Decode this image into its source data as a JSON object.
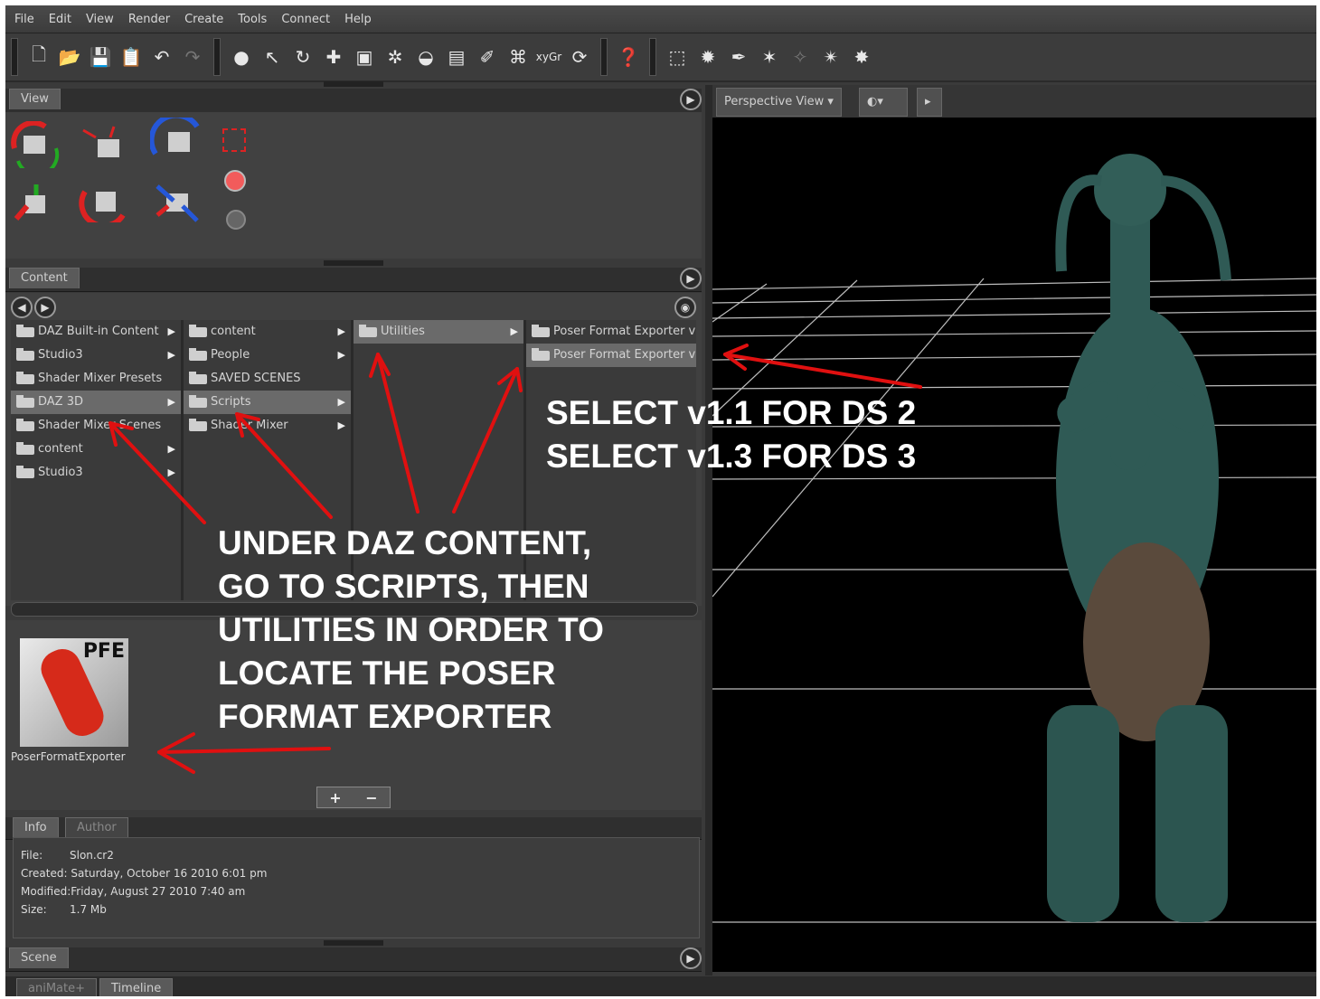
{
  "menu": [
    "File",
    "Edit",
    "View",
    "Render",
    "Create",
    "Tools",
    "Connect",
    "Help"
  ],
  "panels": {
    "view_tab": "View",
    "content_tab": "Content",
    "scene_tab": "Scene",
    "info_tab": "Info",
    "author_tab": "Author"
  },
  "content": {
    "col1": [
      "DAZ Built-in Content",
      "Studio3",
      "Shader Mixer Presets",
      "DAZ 3D",
      "Shader Mixer Scenes",
      "content",
      "Studio3"
    ],
    "col2": [
      "content",
      "People",
      "SAVED SCENES",
      "Scripts",
      "Shader Mixer"
    ],
    "col3": [
      "Utilities"
    ],
    "col4": [
      "Poser Format Exporter v",
      "Poser Format Exporter v"
    ]
  },
  "preview": {
    "badge": "PFE",
    "caption": "PoserFormatExporter",
    "plus": "+",
    "minus": "−"
  },
  "info": {
    "file_label": "File:",
    "file": "Slon.cr2",
    "created_label": "Created:",
    "created": "Saturday, October 16 2010 6:01 pm",
    "modified_label": "Modified:",
    "modified": "Friday, August 27 2010 7:40 am",
    "size_label": "Size:",
    "size": "1.7 Mb"
  },
  "viewport": {
    "camera": "Perspective View"
  },
  "bottom_tabs": [
    "aniMate+",
    "Timeline"
  ],
  "annotations": {
    "select_1": "SELECT v1.1 FOR DS 2",
    "select_2": "SELECT v1.3 FOR DS 3",
    "under_1": "UNDER DAZ CONTENT,",
    "under_2": "GO TO SCRIPTS, THEN",
    "under_3": "UTILITIES IN ORDER TO",
    "under_4": "LOCATE THE POSER",
    "under_5": "FORMAT EXPORTER"
  },
  "colors": {
    "annotation_arrow": "#e01010",
    "ui_background": "#3a3a3a",
    "viewport_background": "#000000",
    "creature_skin": "#2f5a55"
  }
}
